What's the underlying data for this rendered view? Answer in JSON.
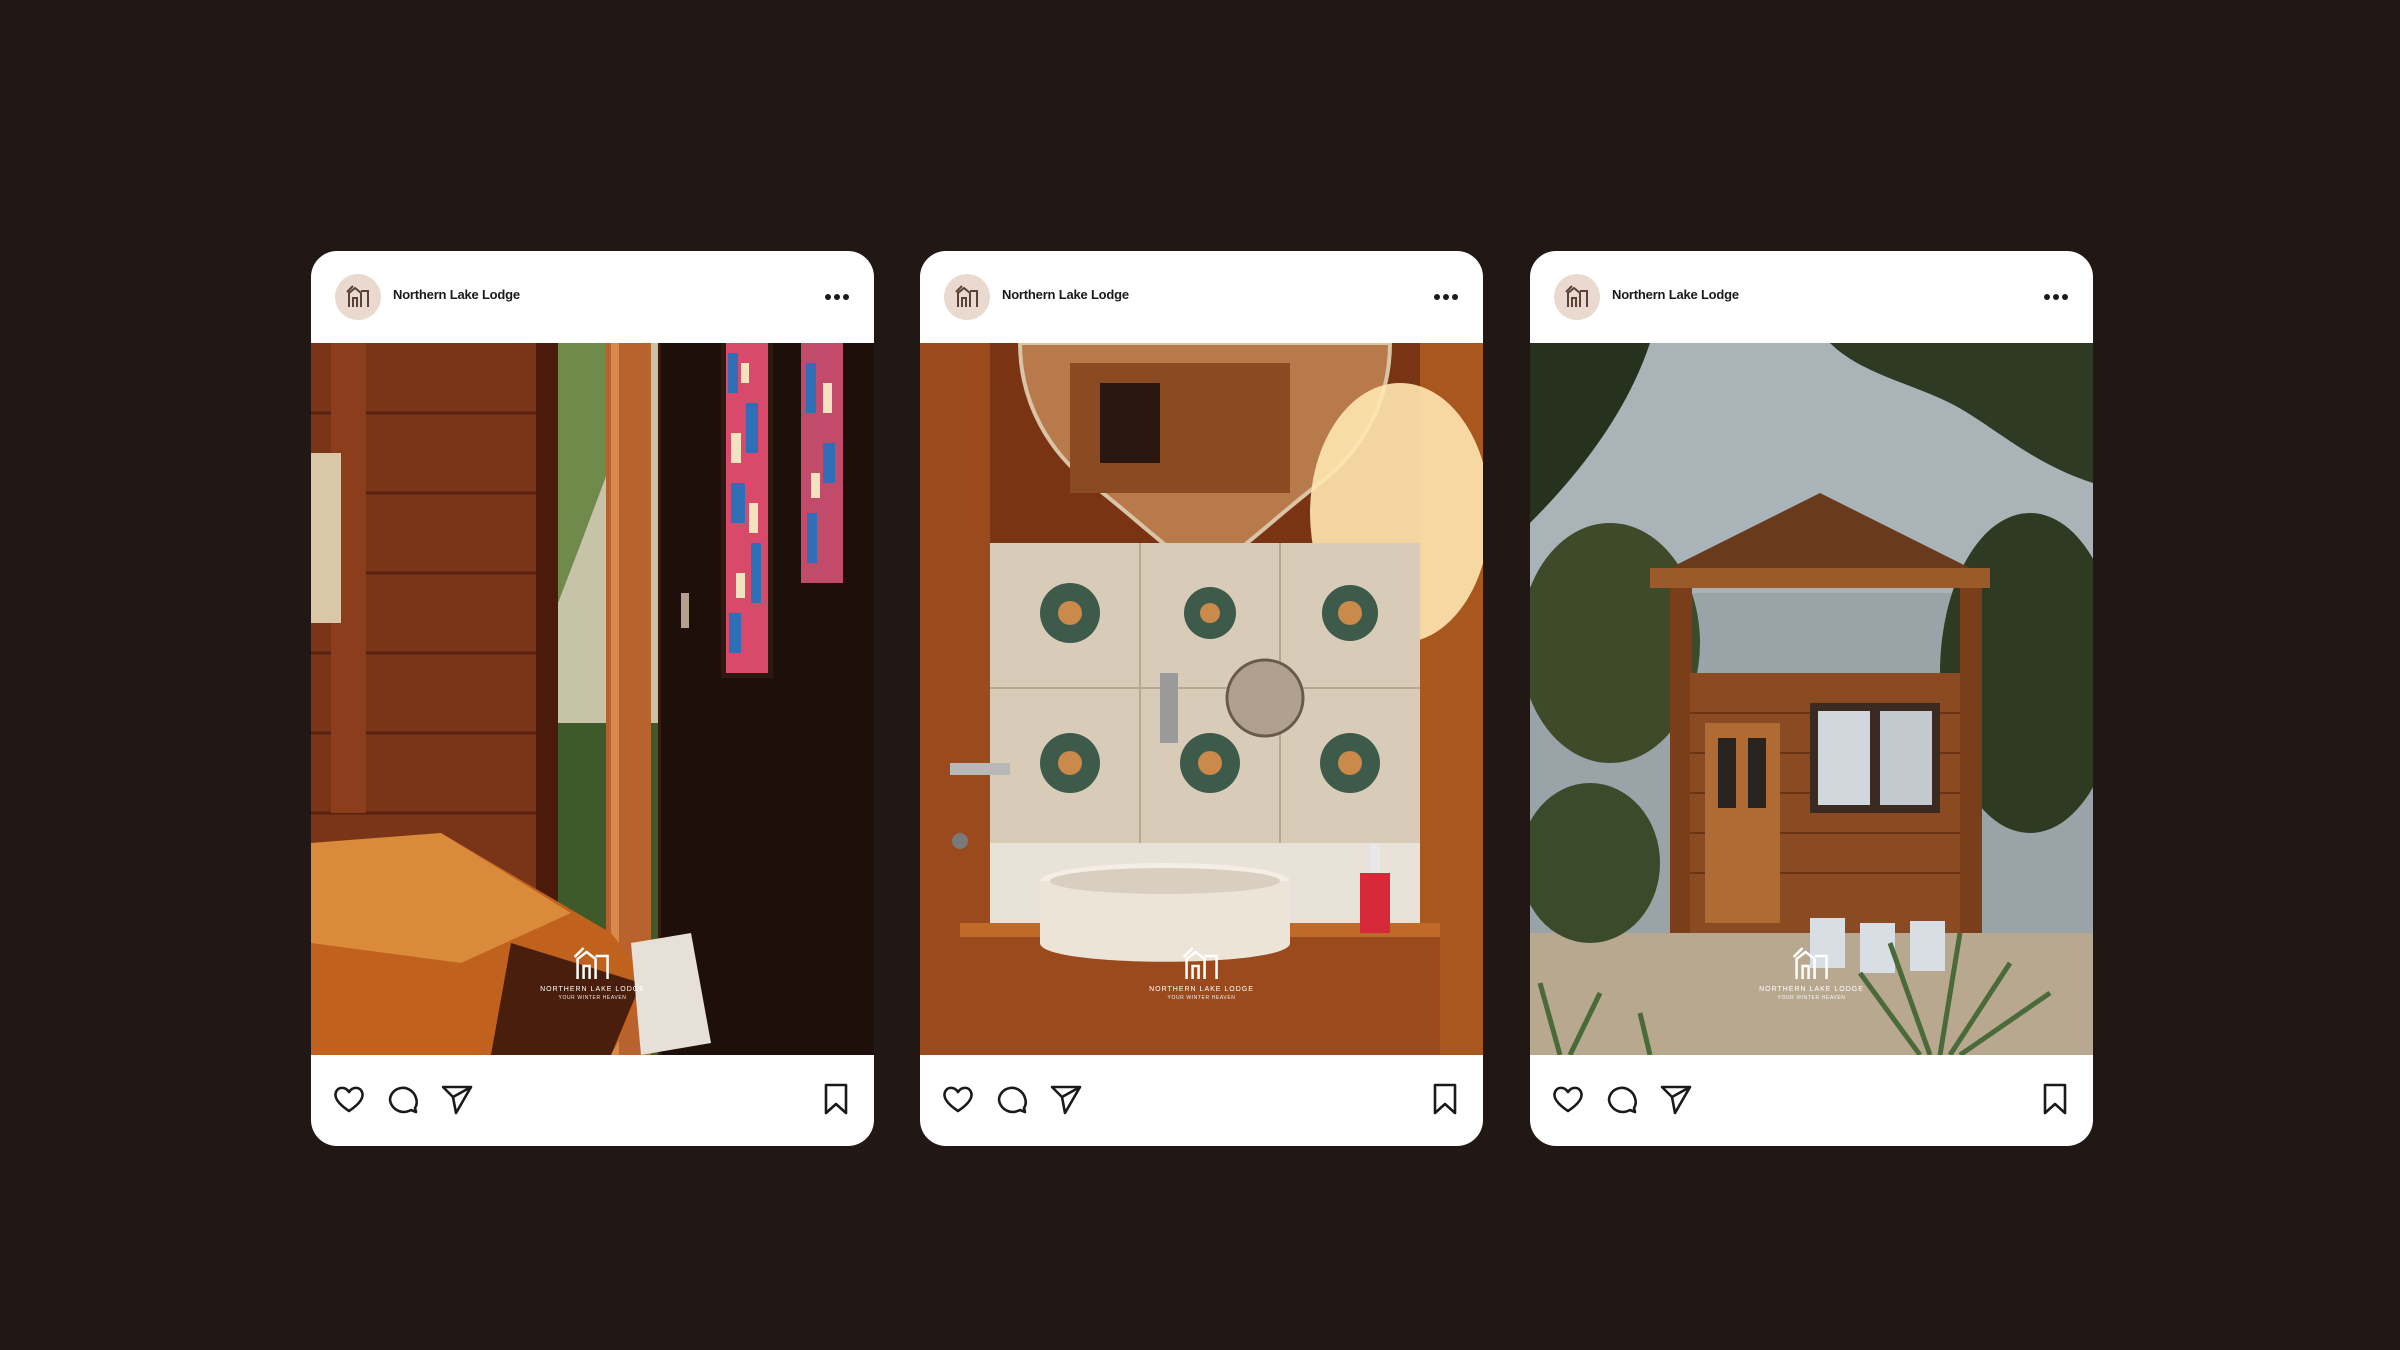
{
  "posts": [
    {
      "username": "Northern Lake Lodge",
      "watermark": {
        "name": "NORTHERN LAKE LODGE",
        "sub": "YOUR WINTER HEAVEN"
      },
      "icons": {
        "avatar": "lodge-logo-icon",
        "more": "more-options-icon",
        "like": "heart-icon",
        "comment": "comment-icon",
        "share": "send-icon",
        "save": "bookmark-icon"
      }
    },
    {
      "username": "Northern Lake Lodge",
      "watermark": {
        "name": "NORTHERN LAKE LODGE",
        "sub": "YOUR WINTER HEAVEN"
      },
      "icons": {
        "avatar": "lodge-logo-icon",
        "more": "more-options-icon",
        "like": "heart-icon",
        "comment": "comment-icon",
        "share": "send-icon",
        "save": "bookmark-icon"
      }
    },
    {
      "username": "Northern Lake Lodge",
      "watermark": {
        "name": "NORTHERN LAKE LODGE",
        "sub": "YOUR WINTER HEAVEN"
      },
      "icons": {
        "avatar": "lodge-logo-icon",
        "more": "more-options-icon",
        "like": "heart-icon",
        "comment": "comment-icon",
        "share": "send-icon",
        "save": "bookmark-icon"
      }
    }
  ],
  "colors": {
    "background": "#211714",
    "card": "#ffffff",
    "avatar_bg": "#e9d9cf",
    "icon": "#1a1a1a"
  }
}
